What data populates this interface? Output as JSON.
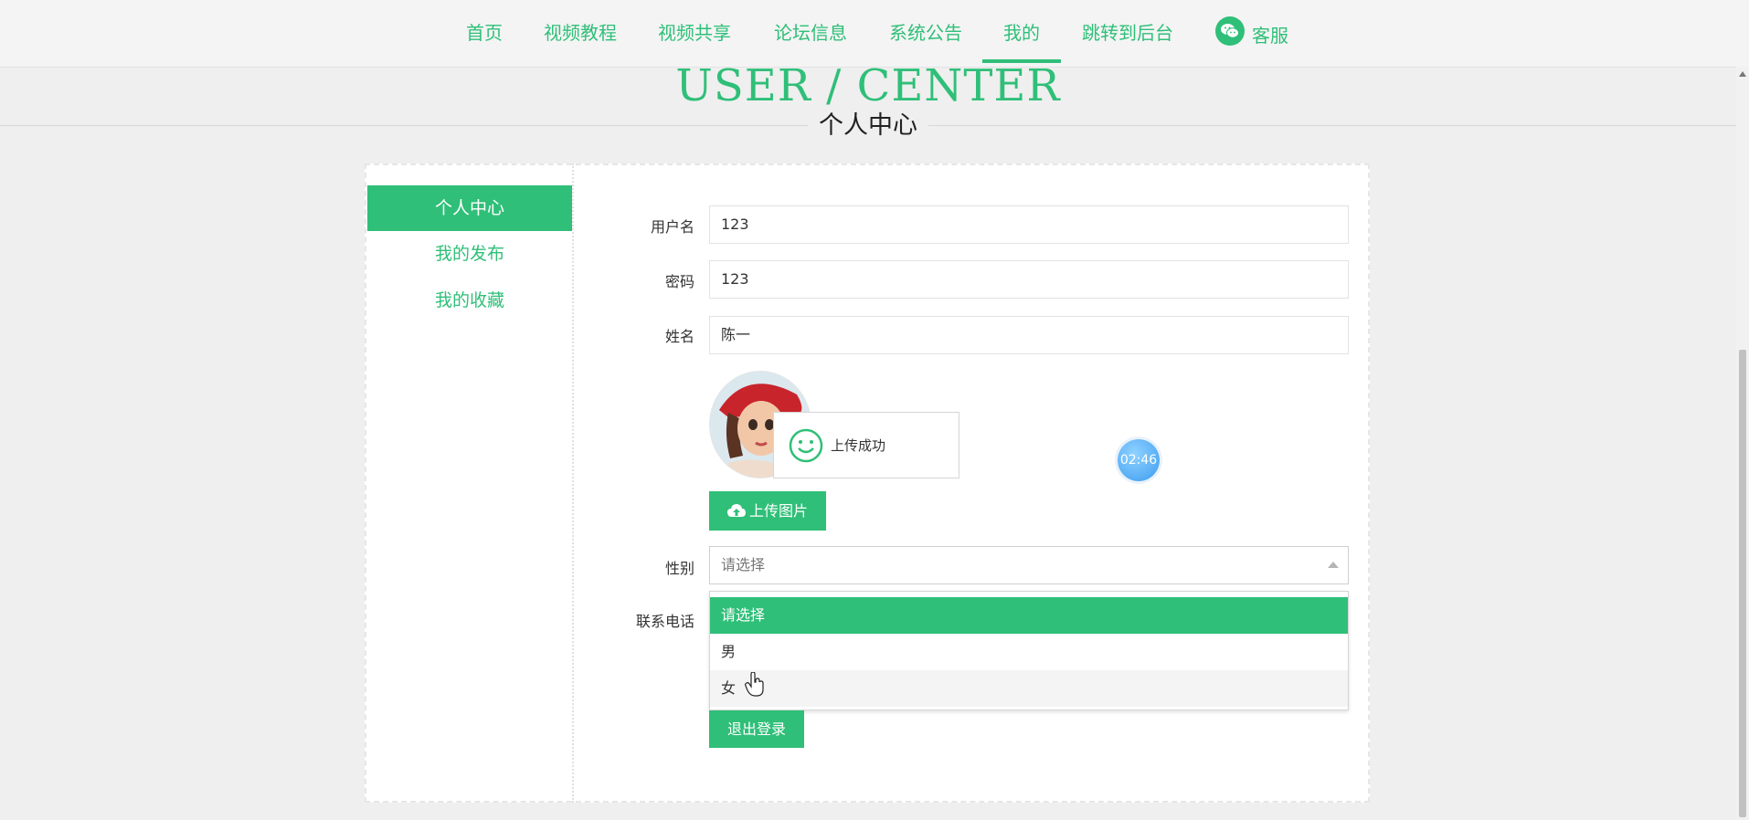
{
  "nav": {
    "items": [
      {
        "label": "首页"
      },
      {
        "label": "视频教程"
      },
      {
        "label": "视频共享"
      },
      {
        "label": "论坛信息"
      },
      {
        "label": "系统公告"
      },
      {
        "label": "我的"
      },
      {
        "label": "跳转到后台"
      }
    ],
    "active_index": 5,
    "service_label": "客服",
    "service_icon": "wechat-icon"
  },
  "hero": {
    "title": "USER / CENTER",
    "subtitle": "个人中心"
  },
  "sidebar": {
    "items": [
      {
        "label": "个人中心"
      },
      {
        "label": "我的发布"
      },
      {
        "label": "我的收藏"
      }
    ],
    "active_index": 0
  },
  "form": {
    "username_label": "用户名",
    "username_value": "123",
    "password_label": "密码",
    "password_value": "123",
    "name_label": "姓名",
    "name_value": "陈一",
    "upload_button": "上传图片",
    "upload_icon": "cloud-upload-icon",
    "toast_text": "上传成功",
    "toast_icon": "smile-icon",
    "gender_label": "性别",
    "gender_placeholder": "请选择",
    "gender_options": [
      "请选择",
      "男",
      "女"
    ],
    "gender_selected_index": 0,
    "gender_hover_index": 2,
    "phone_label": "联系电话",
    "logout_button": "退出登录"
  },
  "timer": "02:46",
  "colors": {
    "accent": "#2fbf78",
    "page_bg": "#efefef"
  }
}
